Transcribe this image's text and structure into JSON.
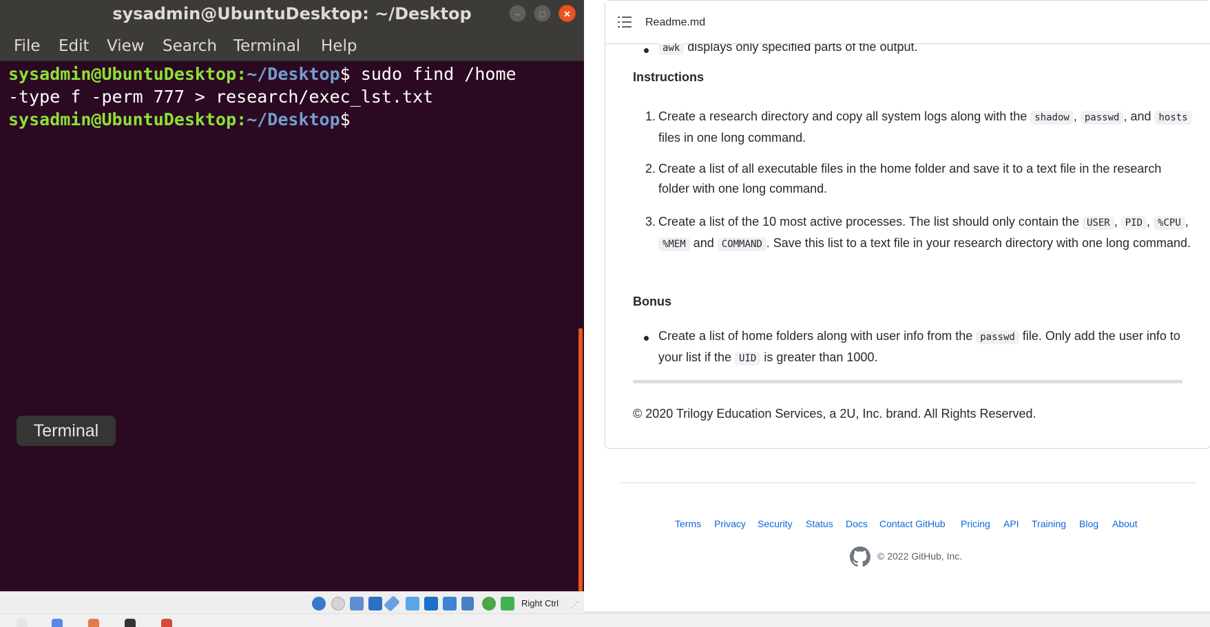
{
  "terminal": {
    "title": "sysadmin@UbuntuDesktop: ~/Desktop",
    "menu": [
      "File",
      "Edit",
      "View",
      "Search",
      "Terminal",
      "Help"
    ],
    "prompt_user": "sysadmin@UbuntuDesktop",
    "prompt_colon": ":",
    "prompt_path": "~/Desktop",
    "prompt_dollar": "$",
    "command_line1": " sudo find /home",
    "command_line2": "-type f -perm 777 > research/exec_lst.txt",
    "tooltip": "Terminal",
    "colors": {
      "background": "#2c0922",
      "prompt_user": "#8ae234",
      "prompt_path": "#729fcf",
      "accent": "#e95420"
    }
  },
  "statusbar": {
    "host_key": "Right Ctrl",
    "icons": [
      "hard-disk-icon",
      "optical-drive-icon",
      "audio-icon",
      "network-icon",
      "usb-icon",
      "shared-folder-icon",
      "display-icon",
      "capture-icon",
      "virtualization-icon",
      "mouse-integration-icon",
      "download-icon"
    ]
  },
  "readme": {
    "filename": "Readme.md",
    "top_bullet": {
      "code": "awk",
      "text": " displays only specified parts of the output."
    },
    "instructions_heading": "Instructions",
    "items": [
      {
        "num": "1.",
        "t1": "Create a research directory and copy all system logs along with the ",
        "c1": "shadow",
        "t2": ", ",
        "c2": "passwd",
        "t3": ", and ",
        "c3": "hosts",
        "t4": " files in one long command."
      },
      {
        "num": "2.",
        "text": "Create a list of all executable files in the home folder and save it to a text file in the research folder with one long command."
      },
      {
        "num": "3.",
        "t1": "Create a list of the 10 most active processes. The list should only contain the ",
        "c1": "USER",
        "t2": ", ",
        "c2": "PID",
        "t3": ", ",
        "c3": "%CPU",
        "t4": ", ",
        "c4": "%MEM",
        "t5": " and ",
        "c5": "COMMAND",
        "t6": ". Save this list to a text file in your research directory with one long command."
      }
    ],
    "bonus_heading": "Bonus",
    "bonus": {
      "t1": "Create a list of home folders along with user info from the ",
      "c1": "passwd",
      "t2": " file. Only add the user info to your list if the ",
      "c2": "UID",
      "t3": " is greater than 1000."
    },
    "copyright": "© 2020 Trilogy Education Services, a 2U, Inc. brand. All Rights Reserved."
  },
  "footer": {
    "links": [
      "Terms",
      "Privacy",
      "Security",
      "Status",
      "Docs",
      "Contact GitHub",
      "Pricing",
      "API",
      "Training",
      "Blog",
      "About"
    ],
    "copyright": "© 2022 GitHub, Inc."
  }
}
